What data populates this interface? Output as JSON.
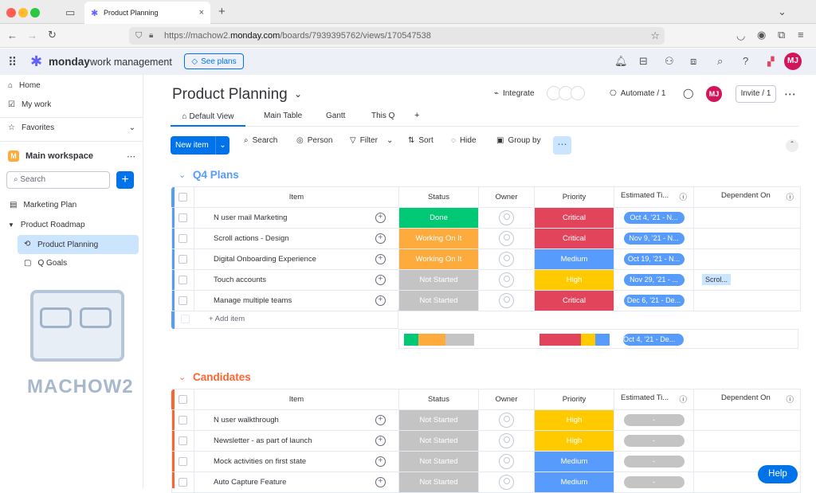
{
  "browser": {
    "tab_title": "Product Planning",
    "url_host": "monday.com",
    "url_pre": "https://machow2.",
    "url_post": "/boards/7939395762/views/170547538"
  },
  "app": {
    "brand": "monday",
    "brand_sub": "work management",
    "see_plans": "See plans",
    "avatar": "MJ"
  },
  "sidebar": {
    "home": "Home",
    "my_work": "My work",
    "favorites": "Favorites",
    "workspace": "Main workspace",
    "workspace_letter": "M",
    "search_placeholder": "Search",
    "items": [
      "Marketing Plan",
      "Product Roadmap",
      "Product Planning",
      "Q Goals"
    ]
  },
  "watermark": "MACHOW2",
  "board": {
    "title": "Product Planning",
    "integrate": "Integrate",
    "automate": "Automate / 1",
    "invite": "Invite / 1",
    "owner_avatar": "MJ",
    "views": [
      "Default View",
      "Main Table",
      "Gantt",
      "This Q",
      "+"
    ],
    "toolbar": {
      "new_item": "New item",
      "search": "Search",
      "person": "Person",
      "filter": "Filter",
      "sort": "Sort",
      "hide": "Hide",
      "group_by": "Group by"
    }
  },
  "columns": [
    "Item",
    "Status",
    "Owner",
    "Priority",
    "Estimated Ti...",
    "Dependent On"
  ],
  "groups": [
    {
      "name": "Q4 Plans",
      "color": "#579bfc",
      "add_item": "+ Add item",
      "summary_date": "Oct 4, '21 - De...",
      "rows": [
        {
          "item": "N user mail Marketing",
          "status": "Done",
          "status_color": "#00c875",
          "priority": "Critical",
          "priority_color": "#e2445c",
          "date": "Oct 4, '21 - N...",
          "dep": ""
        },
        {
          "item": "Scroll actions - Design",
          "status": "Working On It",
          "status_color": "#fdab3d",
          "priority": "Critical",
          "priority_color": "#e2445c",
          "date": "Nov 9, '21 - N...",
          "dep": ""
        },
        {
          "item": "Digital Onboarding Experience",
          "status": "Working On It",
          "status_color": "#fdab3d",
          "priority": "Medium",
          "priority_color": "#579bfc",
          "date": "Oct 19, '21 - N...",
          "dep": ""
        },
        {
          "item": "Touch accounts",
          "status": "Not Started",
          "status_color": "#c4c4c4",
          "priority": "High",
          "priority_color": "#ffcb00",
          "date": "Nov 29, '21 - ...",
          "dep": "Scrol..."
        },
        {
          "item": "Manage multiple teams",
          "status": "Not Started",
          "status_color": "#c4c4c4",
          "priority": "Critical",
          "priority_color": "#e2445c",
          "date": "Dec 6, '21 - De...",
          "dep": ""
        }
      ]
    },
    {
      "name": "Candidates",
      "color": "#e2445c",
      "rows": [
        {
          "item": "N user walkthrough",
          "status": "Not Started",
          "status_color": "#c4c4c4",
          "priority": "High",
          "priority_color": "#ffcb00",
          "date": "-",
          "dep": ""
        },
        {
          "item": "Newsletter - as part of launch",
          "status": "Not Started",
          "status_color": "#c4c4c4",
          "priority": "High",
          "priority_color": "#ffcb00",
          "date": "-",
          "dep": ""
        },
        {
          "item": "Mock activities on first state",
          "status": "Not Started",
          "status_color": "#c4c4c4",
          "priority": "Medium",
          "priority_color": "#579bfc",
          "date": "-",
          "dep": ""
        },
        {
          "item": "Auto Capture Feature",
          "status": "Not Started",
          "status_color": "#c4c4c4",
          "priority": "Medium",
          "priority_color": "#579bfc",
          "date": "-",
          "dep": ""
        }
      ]
    }
  ],
  "help": "Help"
}
